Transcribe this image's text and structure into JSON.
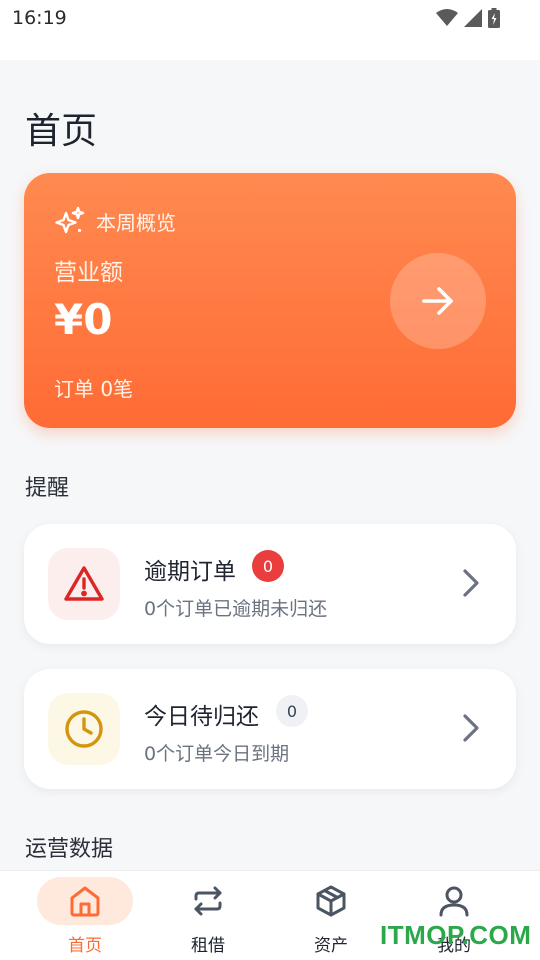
{
  "status_bar": {
    "time": "16:19"
  },
  "page": {
    "title": "首页"
  },
  "summary": {
    "period_label": "本周概览",
    "revenue_label": "营业额",
    "revenue_value": "¥0",
    "orders_text": "订单 0笔"
  },
  "sections": {
    "reminders": "提醒",
    "operations": "运营数据"
  },
  "reminders": [
    {
      "title": "逾期订单",
      "badge": "0",
      "desc": "0个订单已逾期未归还",
      "icon": "warning-icon"
    },
    {
      "title": "今日待归还",
      "badge": "0",
      "desc": "0个订单今日到期",
      "icon": "clock-icon"
    }
  ],
  "nav": [
    {
      "label": "首页",
      "icon": "home-icon",
      "active": true
    },
    {
      "label": "租借",
      "icon": "swap-icon",
      "active": false
    },
    {
      "label": "资产",
      "icon": "box-icon",
      "active": false
    },
    {
      "label": "我的",
      "icon": "user-icon",
      "active": false
    }
  ],
  "watermark": "ITMOP.COM",
  "colors": {
    "accent": "#ff6b35",
    "danger": "#e53935",
    "warning": "#d4940e"
  }
}
